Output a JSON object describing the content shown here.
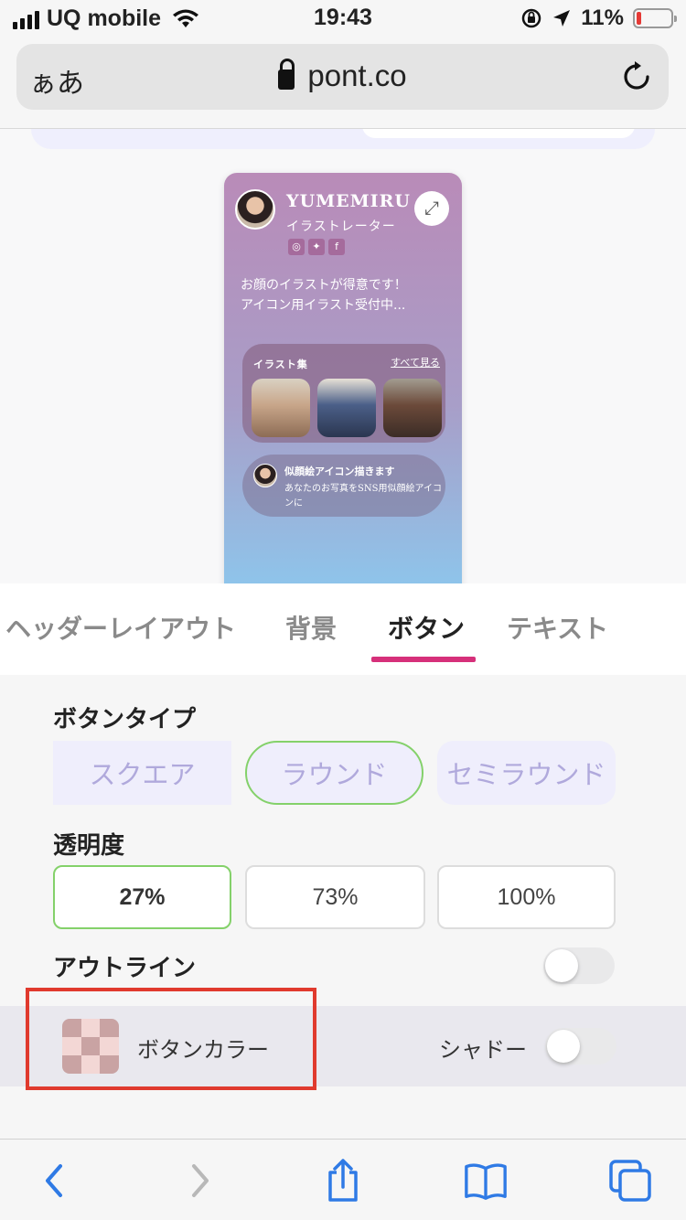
{
  "status_bar": {
    "carrier": "UQ mobile",
    "time": "19:43",
    "battery": "11%",
    "battery_level": 0.11
  },
  "browser": {
    "reader_label": "ぁあ",
    "url": "pont.co"
  },
  "profile_card": {
    "name": "YUMEMIRU",
    "role": "イラストレーター",
    "socials": [
      "instagram-icon",
      "twitter-icon",
      "facebook-icon"
    ],
    "bio_line1": "お顔のイラストが得意です！",
    "bio_line2": "アイコン用イラスト受付中...",
    "gallery_title": "イラスト集",
    "gallery_all": "すべて見る",
    "link_title": "似顔絵アイコン描きます",
    "link_desc": "あなたのお写真をSNS用似顔絵アイコンに"
  },
  "tabs": [
    {
      "label": "ヘッダーレイアウト"
    },
    {
      "label": "背景"
    },
    {
      "label": "ボタン"
    },
    {
      "label": "テキスト"
    }
  ],
  "active_tab": "ボタン",
  "settings": {
    "button_type_label": "ボタンタイプ",
    "button_types": [
      "スクエア",
      "ラウンド",
      "セミラウンド"
    ],
    "selected_button_type": "ラウンド",
    "opacity_label": "透明度",
    "opacity_options": [
      "27%",
      "73%",
      "100%"
    ],
    "selected_opacity": "27%",
    "outline_label": "アウトライン",
    "outline_on": false,
    "button_color_label": "ボタンカラー",
    "shadow_label": "シャドー",
    "shadow_on": false
  },
  "colors": {
    "accent_tab": "#d6307a",
    "selected_border": "#84d16a",
    "highlight": "#e03a2e",
    "ios_blue": "#2f7ae5"
  },
  "toolbar": [
    "back-icon",
    "forward-icon",
    "share-icon",
    "bookmarks-icon",
    "tabs-icon"
  ]
}
